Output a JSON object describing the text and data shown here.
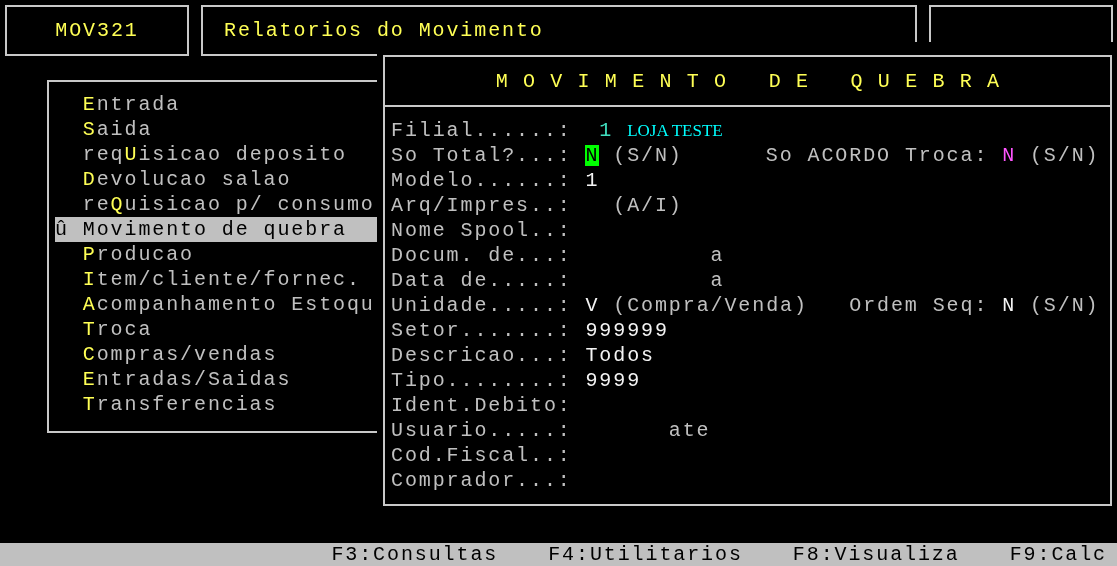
{
  "header": {
    "code": "MOV321",
    "title": "Relatorios do Movimento"
  },
  "menu": {
    "marker": "û",
    "items": [
      {
        "hotkey": "E",
        "after": "ntrada",
        "selected": false
      },
      {
        "hotkey": "S",
        "after": "aida",
        "selected": false
      },
      {
        "before": "req",
        "hotkey": "U",
        "after": "isicao deposito",
        "selected": false
      },
      {
        "hotkey": "D",
        "after": "evolucao salao",
        "selected": false
      },
      {
        "before": "re",
        "hotkey": "Q",
        "after": "uisicao p/ consumo",
        "selected": false
      },
      {
        "hotkey": "M",
        "after": "ovimento de quebra",
        "selected": true
      },
      {
        "hotkey": "P",
        "after": "roducao",
        "selected": false
      },
      {
        "hotkey": "I",
        "after": "tem/cliente/fornec.",
        "selected": false
      },
      {
        "hotkey": "A",
        "after": "companhamento Estoqu",
        "selected": false
      },
      {
        "hotkey": "T",
        "after": "roca",
        "selected": false
      },
      {
        "hotkey": "C",
        "after": "ompras/vendas",
        "selected": false
      },
      {
        "hotkey": "E",
        "after": "ntradas/Saidas",
        "selected": false
      },
      {
        "hotkey": "T",
        "after": "ransferencias",
        "selected": false
      }
    ]
  },
  "form": {
    "title": "MOVIMENTO DE QUEBRA",
    "fields": [
      {
        "label": "Filial......:",
        "kind": "code",
        "value": "1",
        "description": "LOJA TESTE"
      },
      {
        "label": "So Total?...:",
        "kind": "text",
        "value": "N",
        "hint": "(S/N)",
        "focused": true,
        "extra": {
          "label": "So ACORDO Troca:",
          "value": "N",
          "highlighted": true,
          "hint": "(S/N)"
        }
      },
      {
        "label": "Modelo......:",
        "kind": "text",
        "value": "1"
      },
      {
        "label": "Arq/Impres..:",
        "kind": "text",
        "hint": "(A/I)"
      },
      {
        "label": "Nome Spool..:",
        "kind": "text"
      },
      {
        "label": "Docum. de...:",
        "kind": "range",
        "separator": "a"
      },
      {
        "label": "Data de.....:",
        "kind": "range",
        "separator": "a"
      },
      {
        "label": "Unidade.....:",
        "kind": "text",
        "value": "V",
        "hint": "(Compra/Venda)",
        "extra": {
          "label": "Ordem Seq:",
          "value": "N",
          "highlighted": false,
          "hint": "(S/N)"
        }
      },
      {
        "label": "Setor.......:",
        "kind": "text",
        "value": "999999"
      },
      {
        "label": "Descricao...:",
        "kind": "text",
        "value": "Todos"
      },
      {
        "label": "Tipo........:",
        "kind": "text",
        "value": "9999"
      },
      {
        "label": "Ident.Debito:",
        "kind": "text"
      },
      {
        "label": "Usuario.....:",
        "kind": "short_range",
        "separator": "ate"
      },
      {
        "label": "Cod.Fiscal..:",
        "kind": "text"
      },
      {
        "label": "Comprador...:",
        "kind": "text"
      }
    ]
  },
  "function_keys": [
    "F3:Consultas",
    "F4:Utilitarios",
    "F8:Visualiza",
    "F9:Calc"
  ]
}
